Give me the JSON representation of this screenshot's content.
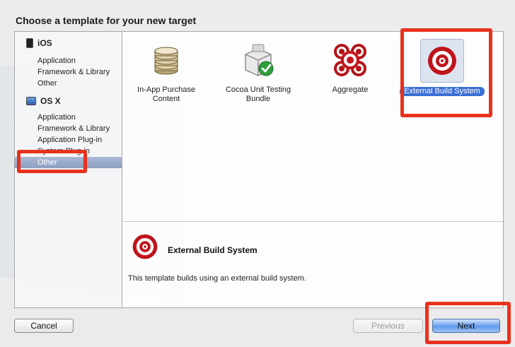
{
  "title": "Choose a template for your new target",
  "sidebar": {
    "sections": [
      {
        "name": "iOS",
        "items": [
          "Application",
          "Framework & Library",
          "Other"
        ]
      },
      {
        "name": "OS X",
        "items": [
          "Application",
          "Framework & Library",
          "Application Plug-in",
          "System Plug-in",
          "Other"
        ]
      }
    ],
    "selected": "Other"
  },
  "templates": [
    {
      "label": "In-App Purchase Content",
      "icon": "coin-stack-icon"
    },
    {
      "label": "Cocoa Unit Testing Bundle",
      "icon": "bundle-check-icon"
    },
    {
      "label": "Aggregate",
      "icon": "aggregate-target-icon"
    },
    {
      "label": "External Build System",
      "icon": "target-icon",
      "selected": true
    }
  ],
  "detail": {
    "title": "External Build System",
    "description": "This template builds using an external build system."
  },
  "buttons": {
    "cancel": "Cancel",
    "previous": "Previous",
    "next": "Next"
  }
}
